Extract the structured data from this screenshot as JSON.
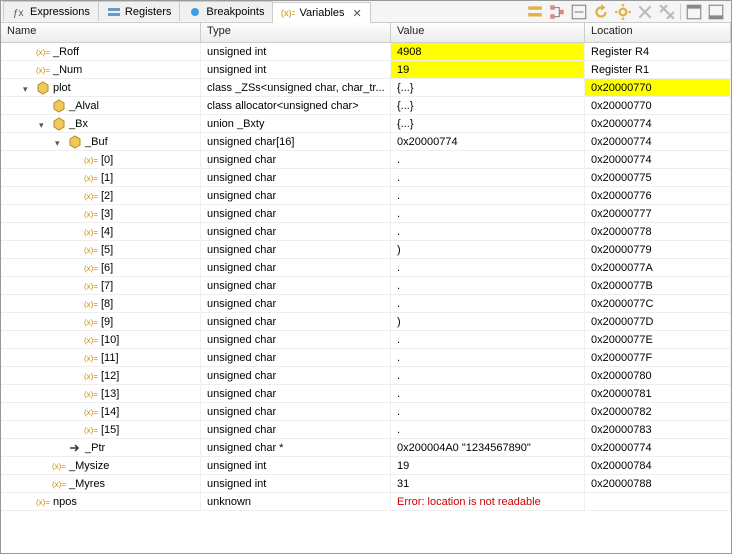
{
  "tabs": [
    {
      "label": "Expressions",
      "icon": "expressions-icon",
      "active": false
    },
    {
      "label": "Registers",
      "icon": "registers-icon",
      "active": false
    },
    {
      "label": "Breakpoints",
      "icon": "breakpoints-icon",
      "active": false
    },
    {
      "label": "Variables",
      "icon": "variables-icon",
      "active": true
    }
  ],
  "toolbar": {
    "btns": [
      "show-type",
      "collapse-all",
      "home",
      "step-into",
      "step-over",
      "remove",
      "remove-all",
      "sep",
      "min",
      "max"
    ]
  },
  "columns": {
    "name": "Name",
    "type": "Type",
    "value": "Value",
    "location": "Location"
  },
  "rows": [
    {
      "indent": 1,
      "twisty": "none",
      "icon": "var",
      "name": "_Roff",
      "type": "unsigned int",
      "value": "4908",
      "location": "Register R4",
      "value_hl": true
    },
    {
      "indent": 1,
      "twisty": "none",
      "icon": "var",
      "name": "_Num",
      "type": "unsigned int",
      "value": "19",
      "location": "Register R1",
      "value_hl": true
    },
    {
      "indent": 1,
      "twisty": "exp",
      "icon": "struct",
      "name": "plot",
      "type": "class _ZSs<unsigned char, char_tr...",
      "value": "{...}",
      "location": "0x20000770",
      "loc_hl": true
    },
    {
      "indent": 2,
      "twisty": "none",
      "icon": "struct",
      "name": "_Alval",
      "type": "class allocator<unsigned char>",
      "value": "{...}",
      "location": "0x20000770"
    },
    {
      "indent": 2,
      "twisty": "exp",
      "icon": "struct",
      "name": "_Bx",
      "type": "union _Bxty",
      "value": "{...}",
      "location": "0x20000774"
    },
    {
      "indent": 3,
      "twisty": "exp",
      "icon": "struct",
      "name": "_Buf",
      "type": "unsigned char[16]",
      "value": "0x20000774",
      "location": "0x20000774"
    },
    {
      "indent": 4,
      "twisty": "none",
      "icon": "var",
      "name": "[0]",
      "type": "unsigned char",
      "value": ".",
      "location": "0x20000774"
    },
    {
      "indent": 4,
      "twisty": "none",
      "icon": "var",
      "name": "[1]",
      "type": "unsigned char",
      "value": ".",
      "location": "0x20000775"
    },
    {
      "indent": 4,
      "twisty": "none",
      "icon": "var",
      "name": "[2]",
      "type": "unsigned char",
      "value": ".",
      "location": "0x20000776"
    },
    {
      "indent": 4,
      "twisty": "none",
      "icon": "var",
      "name": "[3]",
      "type": "unsigned char",
      "value": ".",
      "location": "0x20000777"
    },
    {
      "indent": 4,
      "twisty": "none",
      "icon": "var",
      "name": "[4]",
      "type": "unsigned char",
      "value": ".",
      "location": "0x20000778"
    },
    {
      "indent": 4,
      "twisty": "none",
      "icon": "var",
      "name": "[5]",
      "type": "unsigned char",
      "value": ")",
      "location": "0x20000779"
    },
    {
      "indent": 4,
      "twisty": "none",
      "icon": "var",
      "name": "[6]",
      "type": "unsigned char",
      "value": ".",
      "location": "0x2000077A"
    },
    {
      "indent": 4,
      "twisty": "none",
      "icon": "var",
      "name": "[7]",
      "type": "unsigned char",
      "value": ".",
      "location": "0x2000077B"
    },
    {
      "indent": 4,
      "twisty": "none",
      "icon": "var",
      "name": "[8]",
      "type": "unsigned char",
      "value": ".",
      "location": "0x2000077C"
    },
    {
      "indent": 4,
      "twisty": "none",
      "icon": "var",
      "name": "[9]",
      "type": "unsigned char",
      "value": ")",
      "location": "0x2000077D"
    },
    {
      "indent": 4,
      "twisty": "none",
      "icon": "var",
      "name": "[10]",
      "type": "unsigned char",
      "value": ".",
      "location": "0x2000077E"
    },
    {
      "indent": 4,
      "twisty": "none",
      "icon": "var",
      "name": "[11]",
      "type": "unsigned char",
      "value": ".",
      "location": "0x2000077F"
    },
    {
      "indent": 4,
      "twisty": "none",
      "icon": "var",
      "name": "[12]",
      "type": "unsigned char",
      "value": ".",
      "location": "0x20000780"
    },
    {
      "indent": 4,
      "twisty": "none",
      "icon": "var",
      "name": "[13]",
      "type": "unsigned char",
      "value": ".",
      "location": "0x20000781"
    },
    {
      "indent": 4,
      "twisty": "none",
      "icon": "var",
      "name": "[14]",
      "type": "unsigned char",
      "value": ".",
      "location": "0x20000782"
    },
    {
      "indent": 4,
      "twisty": "none",
      "icon": "var",
      "name": "[15]",
      "type": "unsigned char",
      "value": ".",
      "location": "0x20000783"
    },
    {
      "indent": 3,
      "twisty": "none",
      "icon": "ptr",
      "name": "_Ptr",
      "type": "unsigned char *",
      "value": "0x200004A0 \"1234567890\"",
      "location": "0x20000774"
    },
    {
      "indent": 2,
      "twisty": "none",
      "icon": "var",
      "name": "_Mysize",
      "type": "unsigned int",
      "value": "19",
      "location": "0x20000784"
    },
    {
      "indent": 2,
      "twisty": "none",
      "icon": "var",
      "name": "_Myres",
      "type": "unsigned int",
      "value": "31",
      "location": "0x20000788"
    },
    {
      "indent": 1,
      "twisty": "none",
      "icon": "var",
      "name": "npos",
      "type": "unknown",
      "value": "Error: location is not readable",
      "location": "",
      "value_err": true
    }
  ]
}
